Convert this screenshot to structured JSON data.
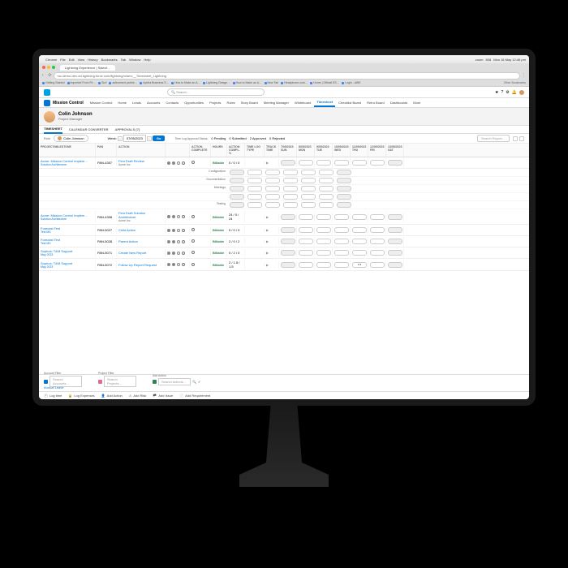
{
  "menubar": {
    "items": [
      "Chrome",
      "File",
      "Edit",
      "View",
      "History",
      "Bookmarks",
      "Tab",
      "Window",
      "Help"
    ],
    "right": [
      "zoom",
      "808",
      "Mon 16 May 12:46 pm"
    ]
  },
  "browser": {
    "tab": "Lightning Experience | Salesf…",
    "url": "mc-demo-dev-ed.lightning.force.com/lightning/n/amc__Timesheet_Lightning",
    "bookmarks": [
      "Getting Started",
      "Imported From Fir…",
      "Surf",
      "authorised partne…",
      "Aprika Business S…",
      "How to Make an A…",
      "Lightning Design…",
      "How to Make an A…",
      "New Tab",
      "Headphone.com…",
      "Home | Official ES…",
      "Login - AWE"
    ]
  },
  "salesforce": {
    "search_placeholder": "Search…",
    "app": "Mission Control",
    "nav": [
      "Mission Control",
      "Home",
      "Leads",
      "Accounts",
      "Contacts",
      "Opportunities",
      "Projects",
      "Roles",
      "Story Board",
      "Meeting Manager",
      "Whiteboard",
      "Timesheet",
      "Checklist Board",
      "Retro Board",
      "Dashboards",
      "More"
    ],
    "active_nav": "Timesheet"
  },
  "header": {
    "name": "Colin Johnson",
    "role": "Project Manager"
  },
  "subtabs": [
    "TIMESHEET",
    "CALENDAR CONVERTER",
    "APPROVALS (7)"
  ],
  "toolbar": {
    "role_label": "Role",
    "user": "Colin Johnson",
    "week_label": "Week:",
    "date": "07/05/2023",
    "go": "Go",
    "approval_label": "Time Log Approval Status:",
    "pending": "0 Pending",
    "submitted": "0 Submitted",
    "approved": "2 Approved",
    "rejected": "0 Rejected",
    "search_placeholder": "Search Report…"
  },
  "columns": [
    "PROJECT/MILESTONE",
    "PAN",
    "ACTION",
    "",
    "ACTION COMPLETE",
    "HOURS",
    "ACTION COMPL. %",
    "TIME LOG TYPE",
    "TRACK TIME",
    "7/05/2023 SUN",
    "8/05/2023 MON",
    "9/05/2023 TUE",
    "10/05/2023 WED",
    "11/05/2023 THU",
    "12/05/2023 FRI",
    "13/05/2023 SAT"
  ],
  "rows": [
    {
      "project": "Acme: Mission Control Implem…",
      "milestone": "Solution Architecture",
      "pan": "PAN-4307",
      "action": "First Draft Review",
      "action_sub": "Acme Inc",
      "hours": "Billable",
      "acp": "0 / 0 / 0",
      "subrows": [
        "Configuration",
        "Documentation",
        "Meetings",
        "",
        "Testing"
      ]
    },
    {
      "project": "Acme: Mission Control Implem…",
      "milestone": "Solution Architecture",
      "pan": "PAN-4308",
      "action": "First Draft Solution Architecture",
      "action_sub": "Acme Inc",
      "hours": "Billable",
      "acp": "24 / 0 / 24"
    },
    {
      "project": "Forecast Test",
      "milestone": "Test MS",
      "pan": "PAN-5027",
      "action": "Child Action",
      "hours": "Billable",
      "acp": "0 / 0 / 0"
    },
    {
      "project": "Forecast Test",
      "milestone": "Test MS",
      "pan": "PAN-5028",
      "action": "Parent Action",
      "hours": "Billable",
      "acp": "2 / 0 / 2"
    },
    {
      "project": "Sophos: T&M Support",
      "milestone": "May 2023",
      "pan": "PAN-5071",
      "action": "Create New Report",
      "hours": "Billable",
      "acp": "0 / 2 / 0"
    },
    {
      "project": "Sophos: T&M Support",
      "milestone": "May 2023",
      "pan": "PAN-5072",
      "action": "Follow Up Report Request",
      "hours": "Billable",
      "acp": "2 / 1.5 / 1.5",
      "thu_val": "1.5"
    }
  ],
  "filters": {
    "account": "Account Filter",
    "account_ph": "Search Accounts…",
    "project": "Project Filter",
    "project_ph": "Search Projects…",
    "add_action": "Add Action",
    "add_action_ph": "Search Actions…"
  },
  "annual_leave": "Annual Leave",
  "bottom": [
    "Log time",
    "Log Expenses",
    "Add Action",
    "Add Risk",
    "Add Issue",
    "Add Requirement"
  ]
}
